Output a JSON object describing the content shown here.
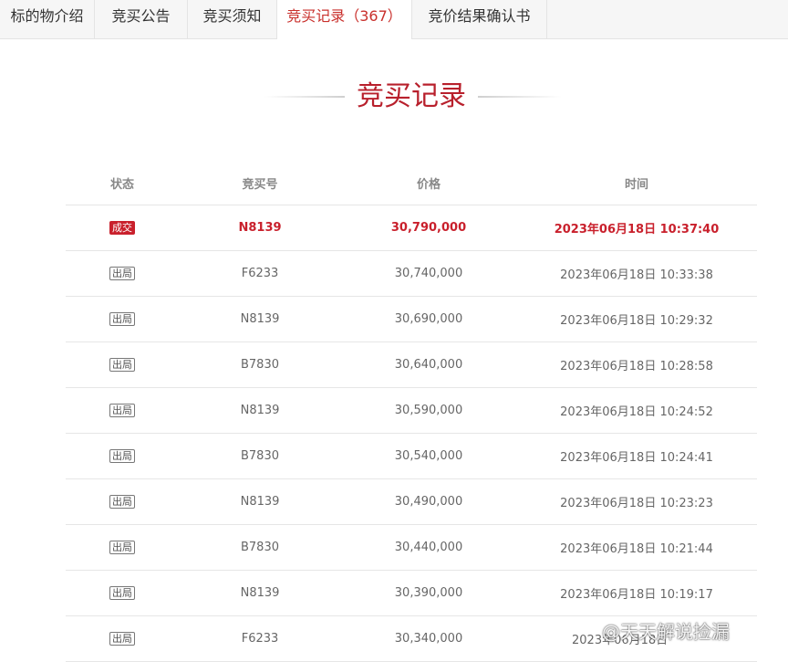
{
  "tabs": [
    {
      "label": "标的物介绍",
      "count": ""
    },
    {
      "label": "竞买公告",
      "count": ""
    },
    {
      "label": "竞买须知",
      "count": ""
    },
    {
      "label": "竞买记录",
      "count": "（367）"
    },
    {
      "label": "竞价结果确认书",
      "count": ""
    }
  ],
  "section_title": "竞买记录",
  "table": {
    "headers": {
      "status": "状态",
      "number": "竞买号",
      "price": "价格",
      "time": "时间"
    },
    "rows": [
      {
        "status": "成交",
        "number": "N8139",
        "price": "30,790,000",
        "time": "2023年06月18日 10:37:40"
      },
      {
        "status": "出局",
        "number": "F6233",
        "price": "30,740,000",
        "time": "2023年06月18日 10:33:38"
      },
      {
        "status": "出局",
        "number": "N8139",
        "price": "30,690,000",
        "time": "2023年06月18日 10:29:32"
      },
      {
        "status": "出局",
        "number": "B7830",
        "price": "30,640,000",
        "time": "2023年06月18日 10:28:58"
      },
      {
        "status": "出局",
        "number": "N8139",
        "price": "30,590,000",
        "time": "2023年06月18日 10:24:52"
      },
      {
        "status": "出局",
        "number": "B7830",
        "price": "30,540,000",
        "time": "2023年06月18日 10:24:41"
      },
      {
        "status": "出局",
        "number": "N8139",
        "price": "30,490,000",
        "time": "2023年06月18日 10:23:23"
      },
      {
        "status": "出局",
        "number": "B7830",
        "price": "30,440,000",
        "time": "2023年06月18日 10:21:44"
      },
      {
        "status": "出局",
        "number": "N8139",
        "price": "30,390,000",
        "time": "2023年06月18日 10:19:17"
      },
      {
        "status": "出局",
        "number": "F6233",
        "price": "30,340,000",
        "time": "2023年06月18日"
      }
    ]
  },
  "watermark": "@天天解说捡漏",
  "colors": {
    "accent": "#c9202c",
    "title": "#b8202c",
    "tabbar": "#f6f6f6"
  }
}
